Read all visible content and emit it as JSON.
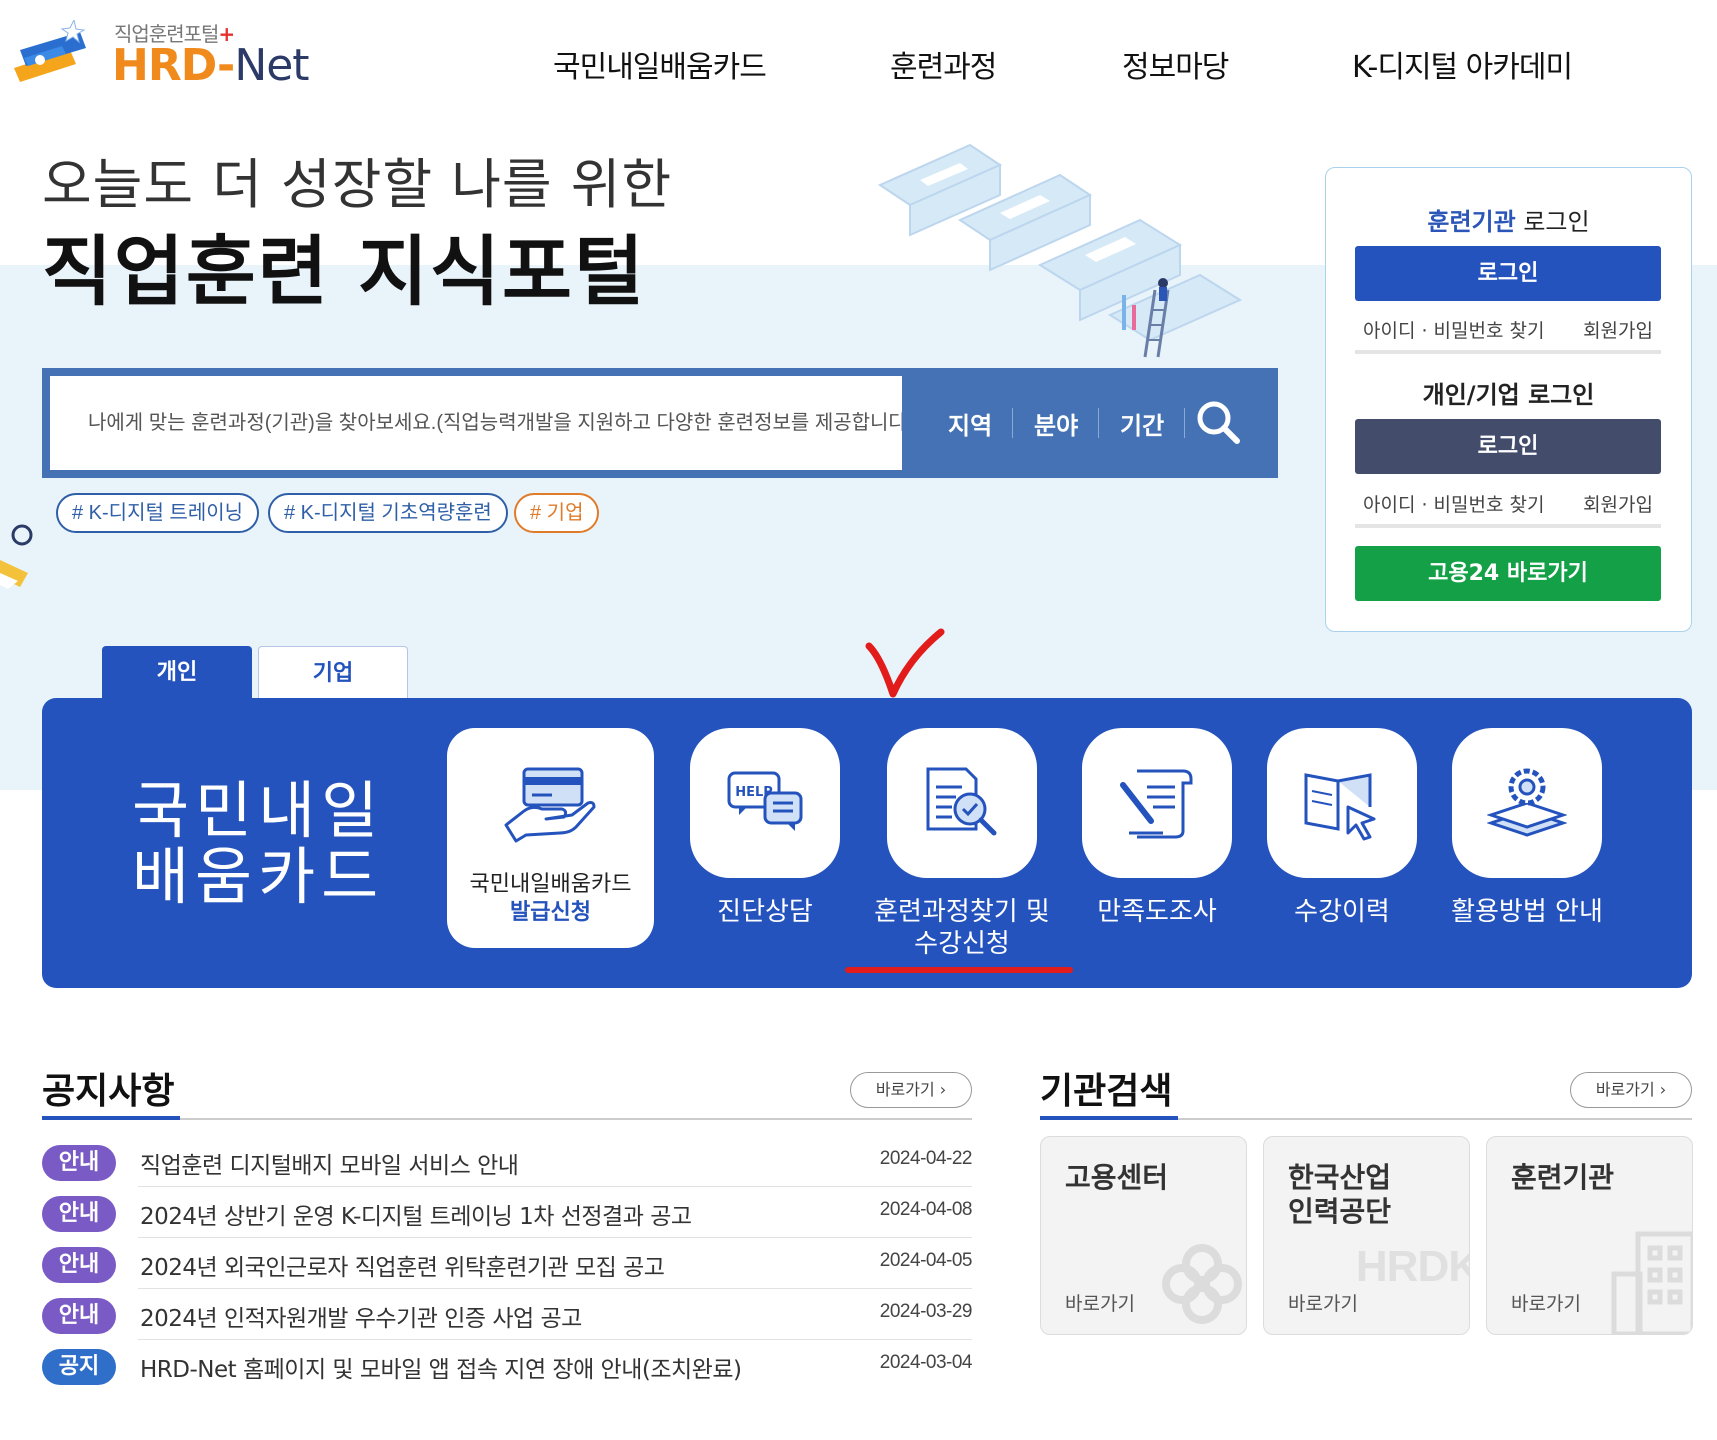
{
  "header": {
    "logo_sub": "직업훈련포털",
    "logo_plus": "+",
    "logo_main": "HRD-",
    "logo_net": "Net",
    "nav": [
      "국민내일배움카드",
      "훈련과정",
      "정보마당",
      "K-디지털 아카데미"
    ]
  },
  "hero": {
    "line1": "오늘도 더 성장할 나를 위한",
    "line2": "직업훈련 지식포털"
  },
  "search": {
    "placeholder": "나에게 맞는 훈련과정(기관)을 찾아보세요.(직업능력개발을 지원하고 다양한 훈련정보를 제공합니다.)",
    "filters": [
      "지역",
      "분야",
      "기간"
    ],
    "tags": [
      "# K-디지털 트레이닝",
      "# K-디지털 기초역량훈련",
      "# 기업"
    ]
  },
  "login": {
    "org_title_hl": "훈련기관",
    "org_title_rest": " 로그인",
    "org_btn": "로그인",
    "find_id": "아이디 · 비밀번호 찾기",
    "join": "회원가입",
    "person_title": "개인/기업",
    "person_title_rest": " 로그인",
    "person_btn": "로그인",
    "goyong_btn": "고용24 바로가기"
  },
  "tabs": [
    "개인",
    "기업"
  ],
  "card": {
    "title_line1": "국민내일",
    "title_line2": "배움카드",
    "issue_line1": "국민내일배움카드",
    "issue_line2": "발급신청",
    "services": [
      {
        "label": "진단상담"
      },
      {
        "label": "훈련과정찾기 및 수강신청"
      },
      {
        "label": "만족도조사"
      },
      {
        "label": "수강이력"
      },
      {
        "label": "활용방법 안내"
      }
    ]
  },
  "notice": {
    "title": "공지사항",
    "more": "바로가기 ›",
    "items": [
      {
        "badge": "안내",
        "title": "직업훈련 디지털배지 모바일 서비스 안내",
        "date": "2024-04-22"
      },
      {
        "badge": "안내",
        "title": "2024년 상반기 운영 K-디지털 트레이닝 1차 선정결과 공고",
        "date": "2024-04-08"
      },
      {
        "badge": "안내",
        "title": "2024년 외국인근로자 직업훈련 위탁훈련기관 모집 공고",
        "date": "2024-04-05"
      },
      {
        "badge": "안내",
        "title": "2024년 인적자원개발 우수기관 인증 사업 공고",
        "date": "2024-03-29"
      },
      {
        "badge": "공지",
        "title": "HRD-Net 홈페이지 및 모바일 앱 접속 지연 장애 안내(조치완료)",
        "date": "2024-03-04"
      }
    ]
  },
  "agency": {
    "title": "기관검색",
    "more": "바로가기 ›",
    "cards": [
      {
        "name": "고용센터",
        "go": "바로가기"
      },
      {
        "name": "한국산업\n인력공단",
        "go": "바로가기"
      },
      {
        "name": "훈련기관",
        "go": "바로가기"
      }
    ],
    "watermark": "HRDK"
  },
  "colors": {
    "primary": "#2453bd",
    "search_bg": "#4472b4",
    "navy": "#434d6b",
    "green": "#14a046",
    "badge_info": "#7a5bc6",
    "badge_notice": "#2f6fc9",
    "annotation_red": "#e21b1b",
    "hero_band": "#e9f3fa"
  }
}
